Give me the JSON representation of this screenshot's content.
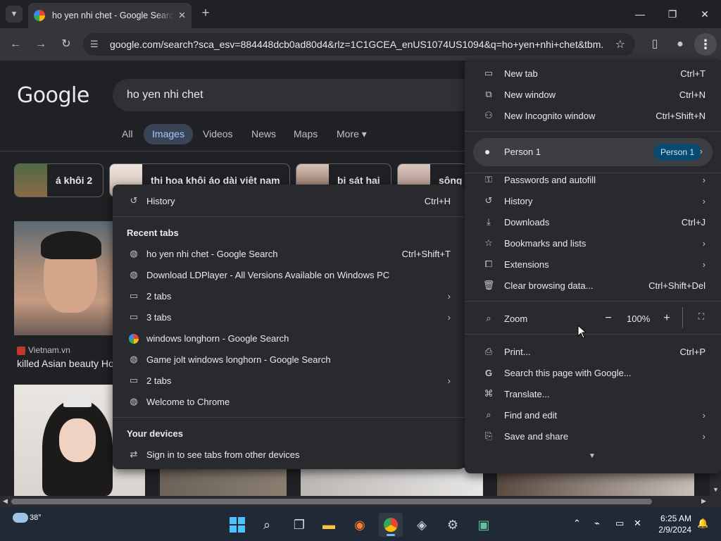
{
  "browser": {
    "tab_title": "ho yen nhi chet - Google Search",
    "url": "google.com/search?sca_esv=884448dcb0ad80d4&rlz=1C1GCEA_enUS1074US1094&q=ho+yen+nhi+chet&tbm..."
  },
  "google": {
    "logo": "Google",
    "query": "ho yen nhi chet",
    "tabs": [
      "All",
      "Images",
      "Videos",
      "News",
      "Maps",
      "More ▾"
    ],
    "chips": [
      "á khôi 2",
      "thi hoa khôi áo dài việt nam",
      "bị sát hại",
      "sông l"
    ],
    "result1_source": "Vietnam.vn",
    "result1_caption": "killed Asian beauty Ho..."
  },
  "main_menu": {
    "new_tab": "New tab",
    "new_tab_sc": "Ctrl+T",
    "new_window": "New window",
    "new_window_sc": "Ctrl+N",
    "incognito": "New Incognito window",
    "incognito_sc": "Ctrl+Shift+N",
    "profile": "Person 1",
    "profile_badge": "Person 1",
    "passwords": "Passwords and autofill",
    "history": "History",
    "downloads": "Downloads",
    "downloads_sc": "Ctrl+J",
    "bookmarks": "Bookmarks and lists",
    "extensions": "Extensions",
    "clear": "Clear browsing data...",
    "clear_sc": "Ctrl+Shift+Del",
    "zoom": "Zoom",
    "zoom_value": "100%",
    "print": "Print...",
    "print_sc": "Ctrl+P",
    "search_page": "Search this page with Google...",
    "translate": "Translate...",
    "find_edit": "Find and edit",
    "save_share": "Save and share"
  },
  "history_menu": {
    "history": "History",
    "history_sc": "Ctrl+H",
    "recent_tabs_header": "Recent tabs",
    "items": [
      {
        "label": "ho yen nhi chet - Google Search",
        "sc": "Ctrl+Shift+T"
      },
      {
        "label": "Download LDPlayer - All Versions Available on Windows PC"
      },
      {
        "label": "2 tabs"
      },
      {
        "label": "3 tabs"
      },
      {
        "label": "windows longhorn - Google Search"
      },
      {
        "label": "Game jolt windows longhorn - Google Search"
      },
      {
        "label": "2 tabs"
      },
      {
        "label": "Welcome to Chrome"
      }
    ],
    "devices_header": "Your devices",
    "devices_item": "Sign in to see tabs from other devices"
  },
  "taskbar": {
    "temperature": "38°",
    "time": "6:25 AM",
    "date": "2/9/2024"
  }
}
